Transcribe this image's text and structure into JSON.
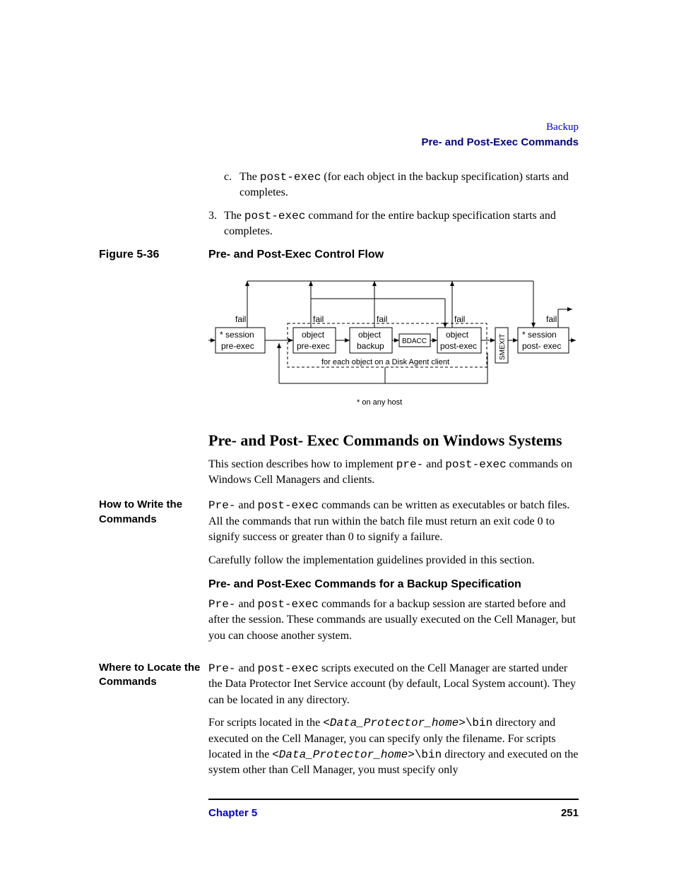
{
  "header": {
    "section": "Backup",
    "subsection": "Pre- and Post-Exec Commands"
  },
  "list_c": {
    "marker": "c.",
    "text_before": "The ",
    "code": "post-exec",
    "text_after": " (for each object in the backup specification) starts and completes."
  },
  "list_3": {
    "marker": "3.",
    "text_before": "The ",
    "code": "post-exec",
    "text_after": " command for the entire backup specification starts and completes."
  },
  "figure": {
    "label": "Figure 5-36",
    "title": "Pre- and Post-Exec Control Flow"
  },
  "diagram": {
    "fail": "fail",
    "star": "*",
    "session": "session",
    "pre_exec": "pre-exec",
    "object": "object",
    "backup": "backup",
    "bdacc": "BDACC",
    "post_exec": "post-exec",
    "post_exec_sp": "post- exec",
    "smexit": "SMEXIT",
    "for_each": "for each object on a Disk Agent client",
    "on_any_host": "* on any host"
  },
  "h2": "Pre- and Post- Exec Commands on Windows Systems",
  "intro": {
    "p1a": "This section describes how to implement ",
    "code1": "pre-",
    "p1b": " and ",
    "code2": "post-exec",
    "p1c": " commands on Windows Cell Managers and clients."
  },
  "howto": {
    "label": "How to Write the Commands",
    "p1a": "Pre-",
    "p1b": " and ",
    "p1c": "post-exec",
    "p1d": " commands can be written as executables or batch files. All the commands that run within the batch file must return an exit code 0 to signify success or greater than 0 to signify a failure.",
    "p2": "Carefully follow the implementation guidelines provided in this section."
  },
  "subh": "Pre- and Post-Exec Commands for a Backup Specification",
  "subp": {
    "a": "Pre-",
    "b": " and ",
    "c": "post-exec",
    "d": " commands for a backup session are started before and after the session. These commands are usually executed on the Cell Manager, but you can choose another system."
  },
  "where": {
    "label": "Where to Locate the Commands",
    "p1a": "Pre-",
    "p1b": " and ",
    "p1c": "post-exec",
    "p1d": " scripts executed on the Cell Manager are started under the Data Protector Inet Service account (by default, Local System account). They can be located in any directory.",
    "p2a": "For scripts located in the ",
    "p2home1": "<Data_Protector_home>",
    "p2b": "\\bin",
    "p2c": " directory and executed on the Cell Manager, you can specify only the filename. For scripts located in the ",
    "p2home2": "<Data_Protector_home>",
    "p2d": "\\bin",
    "p2e": " directory and executed on the system other than Cell Manager, you must specify only"
  },
  "footer": {
    "chapter": "Chapter 5",
    "page": "251"
  }
}
